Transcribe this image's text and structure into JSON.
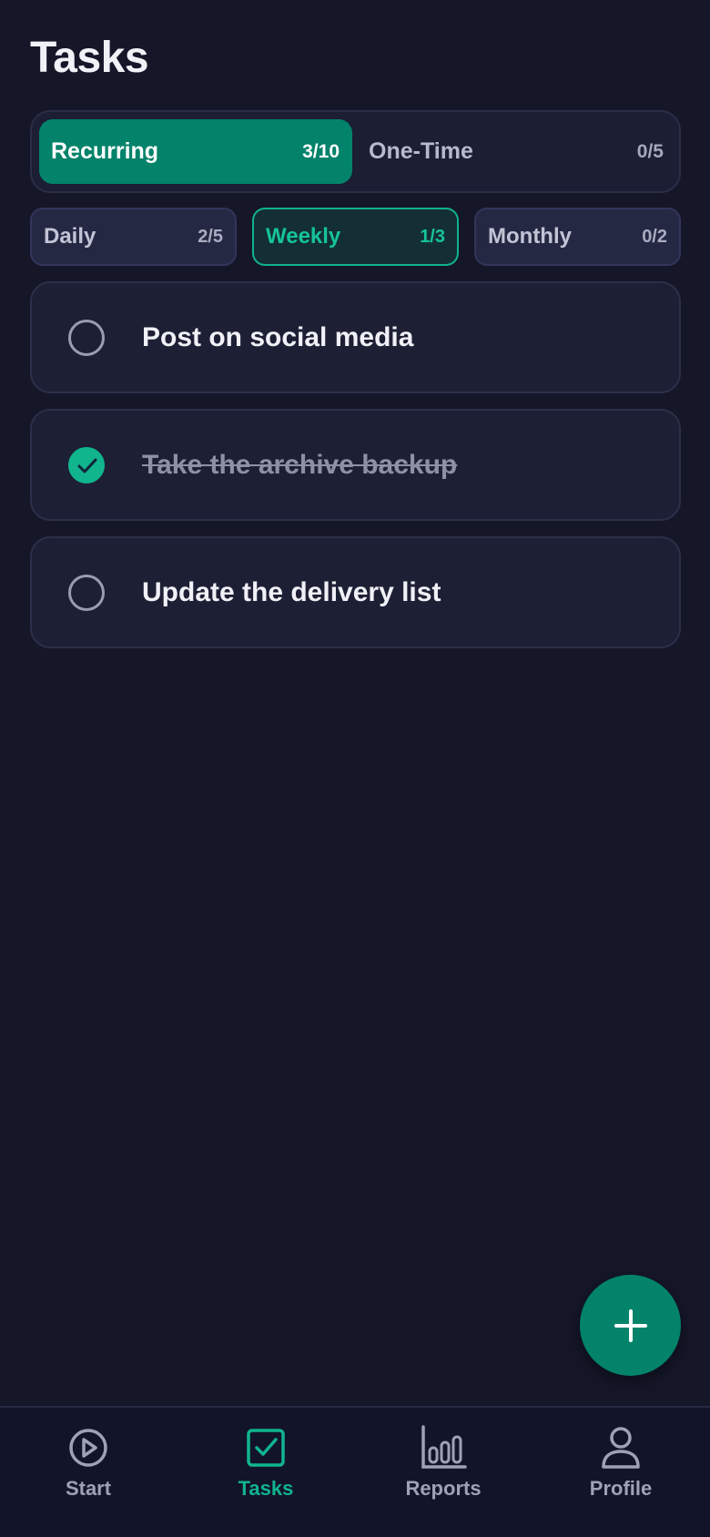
{
  "header": {
    "title": "Tasks"
  },
  "segment": {
    "recurring": {
      "label": "Recurring",
      "count": "3/10",
      "active": true
    },
    "one_time": {
      "label": "One-Time",
      "count": "0/5",
      "active": false
    }
  },
  "filters": {
    "daily": {
      "label": "Daily",
      "count": "2/5"
    },
    "weekly": {
      "label": "Weekly",
      "count": "1/3",
      "active": true
    },
    "monthly": {
      "label": "Monthly",
      "count": "0/2"
    }
  },
  "tasks": [
    {
      "label": "Post on social media",
      "done": false
    },
    {
      "label": "Take the archive backup",
      "done": true
    },
    {
      "label": "Update the delivery list",
      "done": false
    }
  ],
  "fab": {
    "icon": "plus-icon"
  },
  "nav": {
    "start": {
      "label": "Start",
      "icon": "play-circle-icon"
    },
    "tasks": {
      "label": "Tasks",
      "icon": "checkbox-icon",
      "active": true
    },
    "reports": {
      "label": "Reports",
      "icon": "bar-chart-icon"
    },
    "profile": {
      "label": "Profile",
      "icon": "user-icon"
    }
  },
  "colors": {
    "background": "#151729",
    "accent": "#02836A",
    "accent_bright": "#10B58E",
    "card": "#1D1F34"
  }
}
